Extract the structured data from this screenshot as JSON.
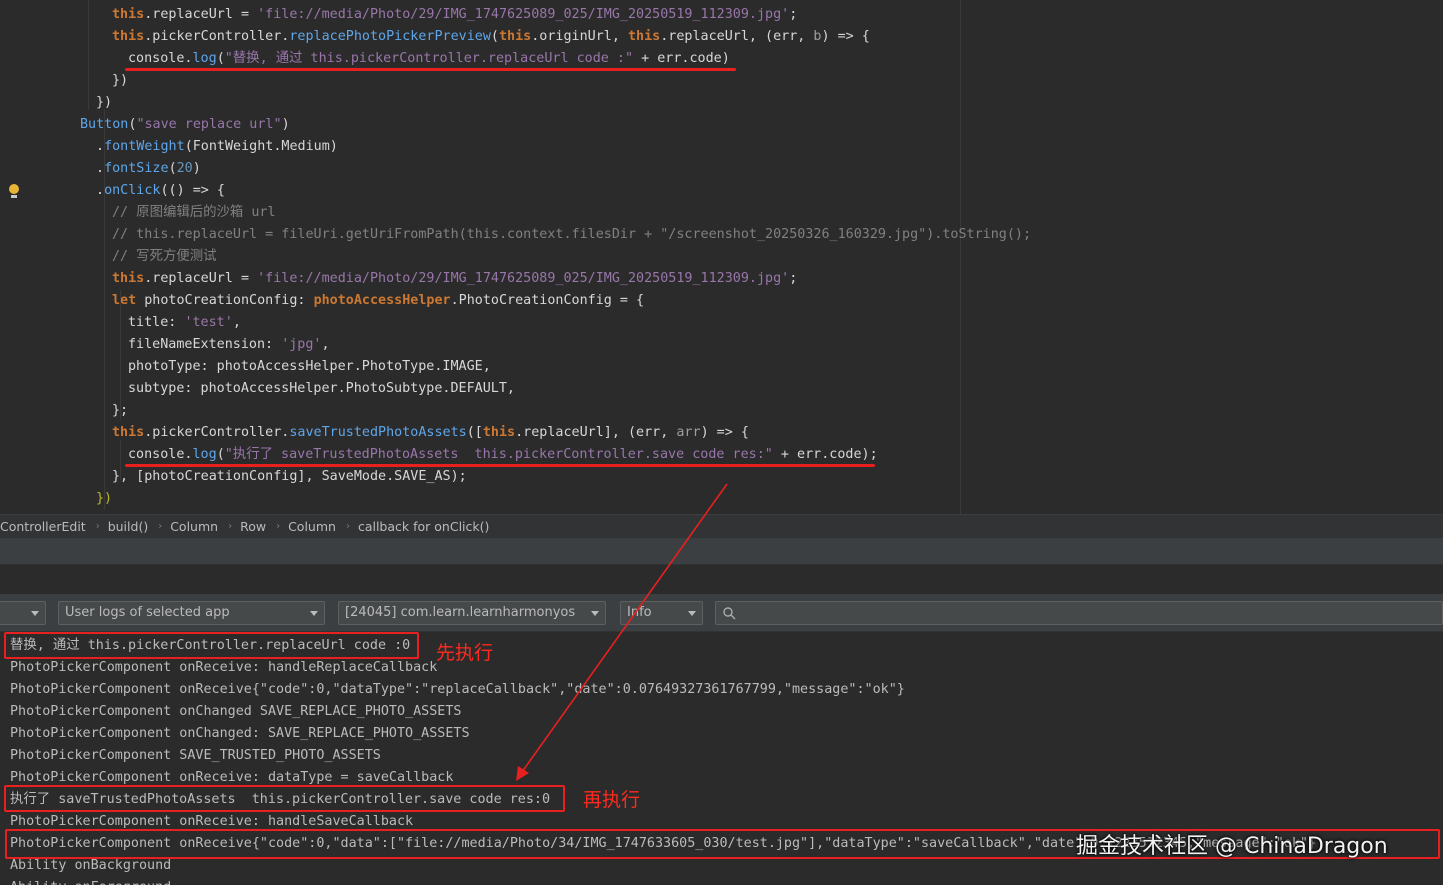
{
  "editor": {
    "lines": [
      {
        "segments": [
          {
            "c": "th",
            "t": "this"
          },
          {
            "c": "plain",
            "t": ".replaceUrl = "
          },
          {
            "c": "strp",
            "t": "'file://media/Photo/29/IMG_1747625089_025/IMG_20250519_112309.jpg'"
          },
          {
            "c": "plain",
            "t": ";"
          }
        ]
      },
      {
        "segments": [
          {
            "c": "th",
            "t": "this"
          },
          {
            "c": "plain",
            "t": ".pickerController."
          },
          {
            "c": "fn",
            "t": "replacePhotoPickerPreview"
          },
          {
            "c": "plain",
            "t": "("
          },
          {
            "c": "th",
            "t": "this"
          },
          {
            "c": "plain",
            "t": ".originUrl, "
          },
          {
            "c": "th",
            "t": "this"
          },
          {
            "c": "plain",
            "t": ".replaceUrl, "
          },
          {
            "c": "plain",
            "t": "(err, "
          },
          {
            "c": "prm",
            "t": "b"
          },
          {
            "c": "plain",
            "t": ") => {"
          }
        ]
      },
      {
        "segments": [
          {
            "c": "plain",
            "t": "console."
          },
          {
            "c": "fn",
            "t": "log"
          },
          {
            "c": "plain",
            "t": "("
          },
          {
            "c": "strp",
            "t": "\"替换, 通过 this.pickerController.replaceUrl code :\""
          },
          {
            "c": "plain",
            "t": " + err.code)"
          }
        ]
      },
      {
        "segments": [
          {
            "c": "plain",
            "t": "})"
          }
        ]
      },
      {
        "segments": [
          {
            "c": "plain",
            "t": "})"
          }
        ]
      },
      {
        "segments": [
          {
            "c": "fn",
            "t": "Button"
          },
          {
            "c": "plain",
            "t": "("
          },
          {
            "c": "strp",
            "t": "\"save replace url\""
          },
          {
            "c": "plain",
            "t": ")"
          }
        ]
      },
      {
        "segments": [
          {
            "c": "plain",
            "t": "."
          },
          {
            "c": "fn",
            "t": "fontWeight"
          },
          {
            "c": "plain",
            "t": "(FontWeight.Medium)"
          }
        ]
      },
      {
        "segments": [
          {
            "c": "plain",
            "t": "."
          },
          {
            "c": "fn",
            "t": "fontSize"
          },
          {
            "c": "plain",
            "t": "("
          },
          {
            "c": "num",
            "t": "20"
          },
          {
            "c": "plain",
            "t": ")"
          }
        ]
      },
      {
        "segments": [
          {
            "c": "plain",
            "t": "."
          },
          {
            "c": "fn",
            "t": "onClick"
          },
          {
            "c": "plain",
            "t": "(() => {"
          }
        ]
      },
      {
        "segments": [
          {
            "c": "cm",
            "t": "// 原图编辑后的沙箱 url"
          }
        ]
      },
      {
        "segments": [
          {
            "c": "cm",
            "t": "// this.replaceUrl = fileUri.getUriFromPath(this.context.filesDir + \"/screenshot_20250326_160329.jpg\").toString();"
          }
        ]
      },
      {
        "segments": [
          {
            "c": "cm",
            "t": "// 写死方便测试"
          }
        ]
      },
      {
        "segments": [
          {
            "c": "th",
            "t": "this"
          },
          {
            "c": "plain",
            "t": ".replaceUrl = "
          },
          {
            "c": "strp",
            "t": "'file://media/Photo/29/IMG_1747625089_025/IMG_20250519_112309.jpg'"
          },
          {
            "c": "plain",
            "t": ";"
          }
        ]
      },
      {
        "segments": [
          {
            "c": "kw",
            "t": "let "
          },
          {
            "c": "plain",
            "t": "photoCreationConfig: "
          },
          {
            "c": "kw",
            "t": "photoAccessHelper"
          },
          {
            "c": "plain",
            "t": ".PhotoCreationConfig = {"
          }
        ]
      },
      {
        "segments": [
          {
            "c": "plain",
            "t": "title: "
          },
          {
            "c": "strp",
            "t": "'test'"
          },
          {
            "c": "plain",
            "t": ","
          }
        ]
      },
      {
        "segments": [
          {
            "c": "plain",
            "t": "fileNameExtension: "
          },
          {
            "c": "strp",
            "t": "'jpg'"
          },
          {
            "c": "plain",
            "t": ","
          }
        ]
      },
      {
        "segments": [
          {
            "c": "plain",
            "t": "photoType: photoAccessHelper.PhotoType.IMAGE,"
          }
        ]
      },
      {
        "segments": [
          {
            "c": "plain",
            "t": "subtype: photoAccessHelper.PhotoSubtype.DEFAULT,"
          }
        ]
      },
      {
        "segments": [
          {
            "c": "plain",
            "t": "};"
          }
        ]
      },
      {
        "segments": [
          {
            "c": "th",
            "t": "this"
          },
          {
            "c": "plain",
            "t": ".pickerController."
          },
          {
            "c": "fn",
            "t": "saveTrustedPhotoAssets"
          },
          {
            "c": "plain",
            "t": "(["
          },
          {
            "c": "th",
            "t": "this"
          },
          {
            "c": "plain",
            "t": ".replaceUrl], (err, "
          },
          {
            "c": "prm",
            "t": "arr"
          },
          {
            "c": "plain",
            "t": ") => {"
          }
        ]
      },
      {
        "segments": [
          {
            "c": "plain",
            "t": "console."
          },
          {
            "c": "fn",
            "t": "log"
          },
          {
            "c": "plain",
            "t": "("
          },
          {
            "c": "strp",
            "t": "\"执行了 saveTrustedPhotoAssets  this.pickerController.save code res:\""
          },
          {
            "c": "plain",
            "t": " + err.code);"
          }
        ]
      },
      {
        "segments": [
          {
            "c": "plain",
            "t": "}, [photoCreationConfig], SaveMode.SAVE_AS);"
          }
        ]
      },
      {
        "segments": [
          {
            "c": "hl",
            "t": "})"
          }
        ]
      }
    ]
  },
  "breadcrumb": [
    "ControllerEdit",
    "build()",
    "Column",
    "Row",
    "Column",
    "callback for onClick()"
  ],
  "filters": {
    "device": "",
    "log_scope": "User logs of selected app",
    "process": "[24045] com.learn.learnharmonyos",
    "level": "Info",
    "search_placeholder": ""
  },
  "logs": [
    "替换, 通过 this.pickerController.replaceUrl code :0",
    "PhotoPickerComponent onReceive: handleReplaceCallback",
    "PhotoPickerComponent onReceive{\"code\":0,\"dataType\":\"replaceCallback\",\"date\":0.07649327361767799,\"message\":\"ok\"}",
    "PhotoPickerComponent onChanged SAVE_REPLACE_PHOTO_ASSETS",
    "PhotoPickerComponent onChanged: SAVE_REPLACE_PHOTO_ASSETS",
    "PhotoPickerComponent SAVE_TRUSTED_PHOTO_ASSETS",
    "PhotoPickerComponent onReceive: dataType = saveCallback",
    "执行了 saveTrustedPhotoAssets  this.pickerController.save code res:0",
    "PhotoPickerComponent onReceive: handleSaveCallback",
    "PhotoPickerComponent onReceive{\"code\":0,\"data\":[\"file://media/Photo/34/IMG_1747633605_030/test.jpg\"],\"dataType\":\"saveCallback\",\"date\":0.1223512345,\"message\":\"ok\"}",
    "Ability onBackground",
    "Ability onForeground"
  ],
  "annotations": {
    "first": "先执行",
    "second": "再执行",
    "watermark": "掘金技术社区 @ ChinaDragon"
  },
  "colors": {
    "annotation_red": "#e8201f",
    "editor_bg": "#2b2b2b",
    "panel_bg": "#3c3f41"
  }
}
